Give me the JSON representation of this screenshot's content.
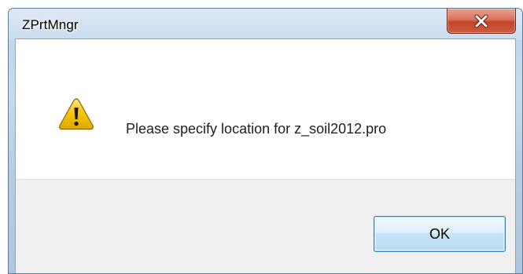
{
  "window": {
    "title": "ZPrtMngr",
    "close_icon": "close-x-icon"
  },
  "dialog": {
    "icon": "warning-icon",
    "message": "Please specify location for z_soil2012.pro",
    "ok_label": "OK"
  },
  "colors": {
    "frame": "#b9d1ea",
    "close_button": "#c7462c",
    "button_area": "#f0f0f0",
    "ok_border": "#3c7fb1",
    "warning_fill": "#f5c400"
  }
}
